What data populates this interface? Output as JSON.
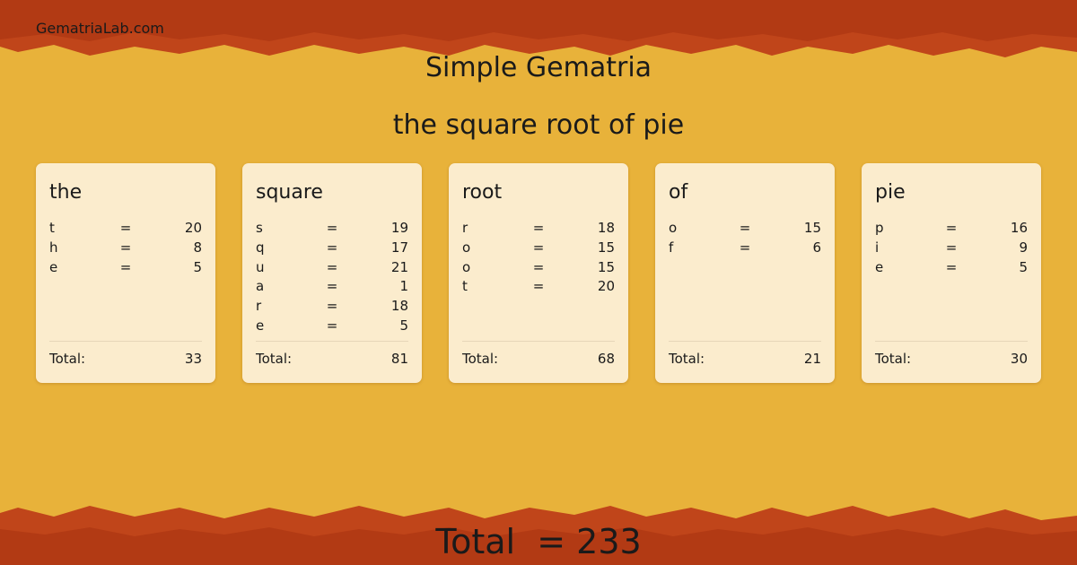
{
  "site": "GematriaLab.com",
  "title": "Simple Gematria",
  "phrase": "the square root of pie",
  "colors": {
    "background": "#e8b23a",
    "border": "#c0451a",
    "card": "#fbeccd"
  },
  "words": [
    {
      "word": "the",
      "letters": [
        {
          "ch": "t",
          "val": "20"
        },
        {
          "ch": "h",
          "val": "8"
        },
        {
          "ch": "e",
          "val": "5"
        }
      ],
      "total_label": "Total:",
      "total": "33"
    },
    {
      "word": "square",
      "letters": [
        {
          "ch": "s",
          "val": "19"
        },
        {
          "ch": "q",
          "val": "17"
        },
        {
          "ch": "u",
          "val": "21"
        },
        {
          "ch": "a",
          "val": "1"
        },
        {
          "ch": "r",
          "val": "18"
        },
        {
          "ch": "e",
          "val": "5"
        }
      ],
      "total_label": "Total:",
      "total": "81"
    },
    {
      "word": "root",
      "letters": [
        {
          "ch": "r",
          "val": "18"
        },
        {
          "ch": "o",
          "val": "15"
        },
        {
          "ch": "o",
          "val": "15"
        },
        {
          "ch": "t",
          "val": "20"
        }
      ],
      "total_label": "Total:",
      "total": "68"
    },
    {
      "word": "of",
      "letters": [
        {
          "ch": "o",
          "val": "15"
        },
        {
          "ch": "f",
          "val": "6"
        }
      ],
      "total_label": "Total:",
      "total": "21"
    },
    {
      "word": "pie",
      "letters": [
        {
          "ch": "p",
          "val": "16"
        },
        {
          "ch": "i",
          "val": "9"
        },
        {
          "ch": "e",
          "val": "5"
        }
      ],
      "total_label": "Total:",
      "total": "30"
    }
  ],
  "equals_sign": "=",
  "grand_total": "Total  = 233"
}
